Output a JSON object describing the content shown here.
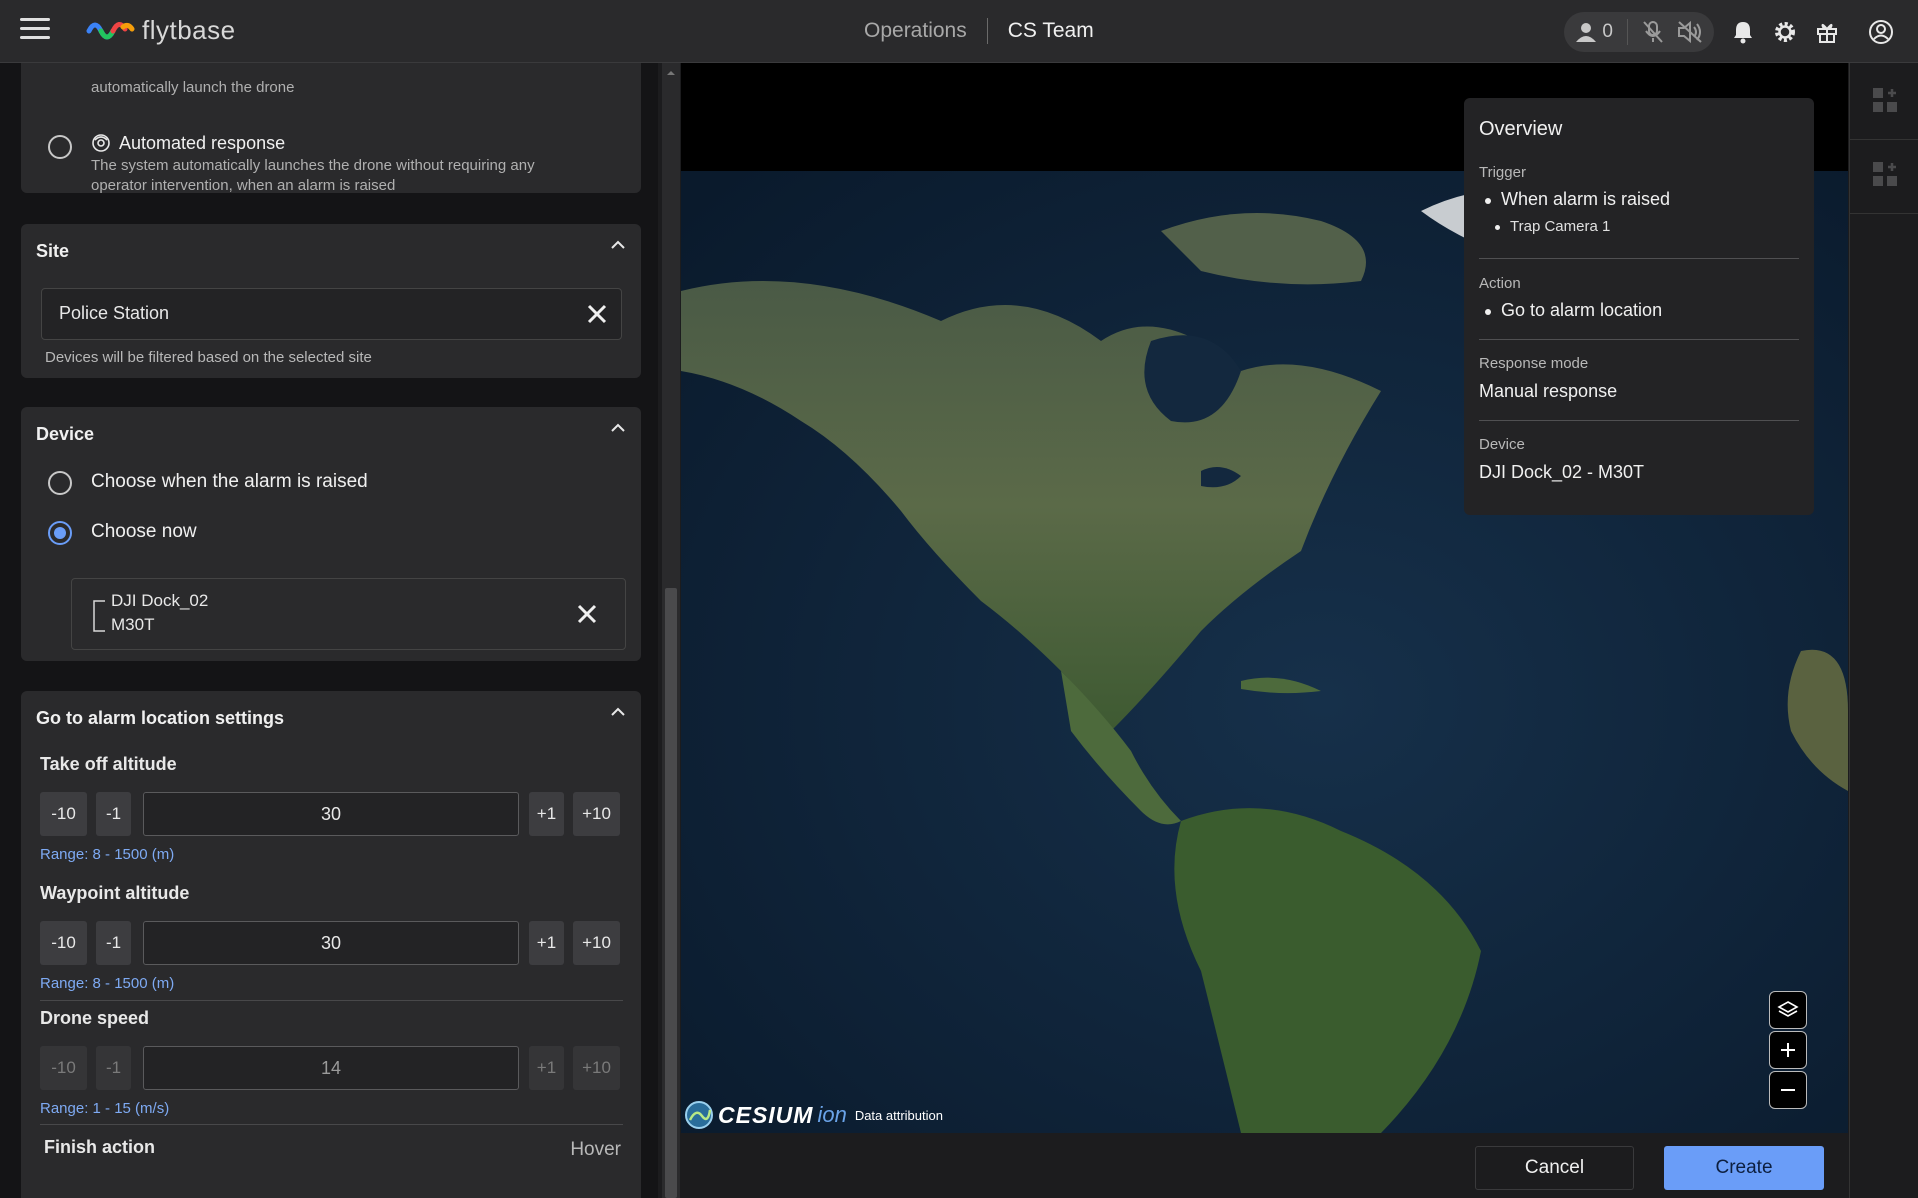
{
  "header": {
    "logo_text": "flytbase",
    "nav_operations": "Operations",
    "nav_team": "CS Team",
    "user_count": "0"
  },
  "response_mode": {
    "prev_option_desc_tail": "automatically launch the drone",
    "automated_label": "Automated response",
    "automated_desc": "The system automatically launches the drone without requiring any operator intervention, when an alarm is raised"
  },
  "site": {
    "title": "Site",
    "value": "Police Station",
    "help": "Devices will be filtered based on the selected site"
  },
  "device": {
    "title": "Device",
    "option_later": "Choose when the alarm is raised",
    "option_now": "Choose now",
    "selected_line1": "DJI Dock_02",
    "selected_line2": "M30T"
  },
  "settings": {
    "title": "Go to alarm location settings",
    "takeoff": {
      "label": "Take off altitude",
      "value": "30",
      "range": "Range: 8 - 1500 (m)"
    },
    "waypoint": {
      "label": "Waypoint altitude",
      "value": "30",
      "range": "Range: 8 - 1500 (m)"
    },
    "speed": {
      "label": "Drone speed",
      "value": "14",
      "range": "Range: 1 - 15 (m/s)"
    },
    "step_labels": {
      "m10": "-10",
      "m1": "-1",
      "p1": "+1",
      "p10": "+10"
    },
    "finish_label": "Finish action",
    "finish_value": "Hover"
  },
  "overview": {
    "title": "Overview",
    "trigger_label": "Trigger",
    "trigger_value": "When alarm is raised",
    "trigger_sub": "Trap Camera 1",
    "action_label": "Action",
    "action_value": "Go to alarm location",
    "mode_label": "Response mode",
    "mode_value": "Manual response",
    "device_label": "Device",
    "device_value": "DJI Dock_02 - M30T"
  },
  "map": {
    "brand": "CESIUM",
    "brand_suffix": "ion",
    "attribution": "Data attribution"
  },
  "footer": {
    "cancel": "Cancel",
    "create": "Create"
  },
  "colors": {
    "accent": "#6a9df8",
    "range_text": "#7eaaf3",
    "panel_bg": "#2a2a2c"
  }
}
